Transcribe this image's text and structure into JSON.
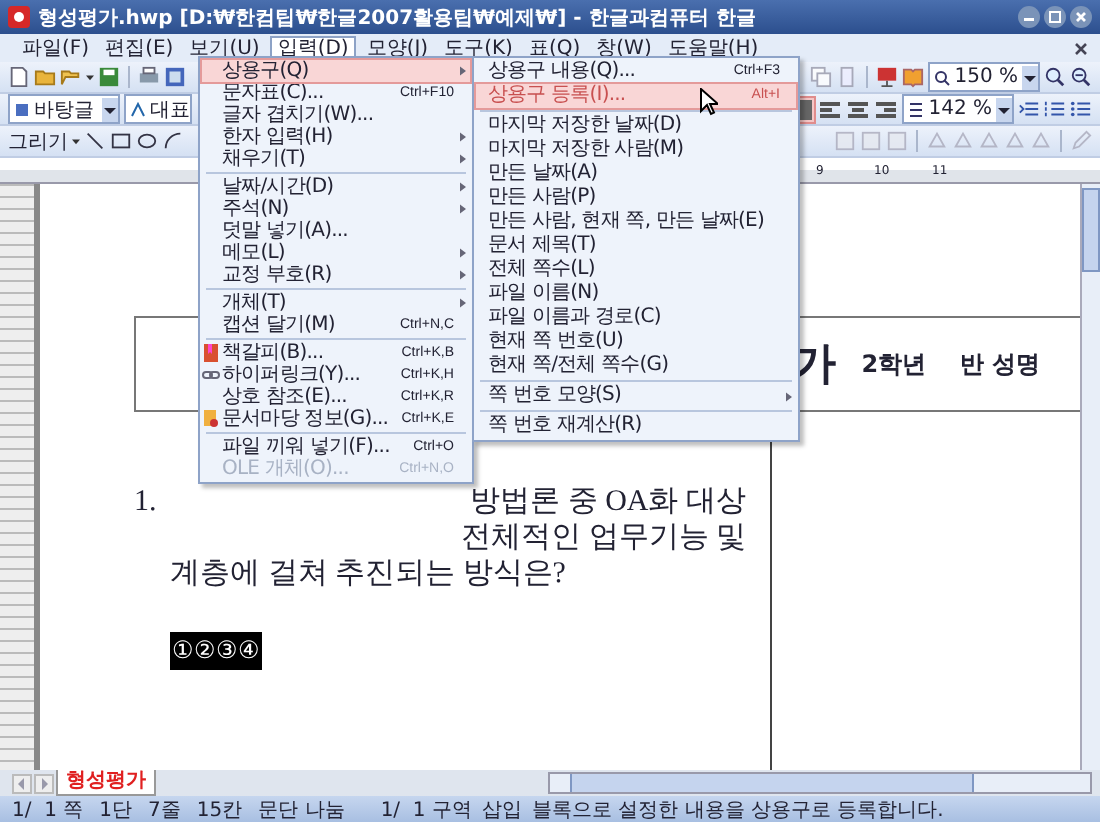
{
  "window": {
    "title": "형성평가.hwp [D:₩한컴팁₩한글2007활용팁₩예제₩] - 한글과컴퓨터 한글"
  },
  "menubar": [
    {
      "label": "파일(F)",
      "selected": false
    },
    {
      "label": "편집(E)",
      "selected": false
    },
    {
      "label": "보기(U)",
      "selected": false
    },
    {
      "label": "입력(D)",
      "selected": true
    },
    {
      "label": "모양(J)",
      "selected": false
    },
    {
      "label": "도구(K)",
      "selected": false
    },
    {
      "label": "표(Q)",
      "selected": false
    },
    {
      "label": "창(W)",
      "selected": false
    },
    {
      "label": "도움말(H)",
      "selected": false
    }
  ],
  "toolbar": {
    "style": "바탕글",
    "font": "대표",
    "zoom": "150 %",
    "paragraph_zoom": "142 %",
    "draw_label": "그리기",
    "alignment": [
      {
        "selected": true
      },
      {
        "selected": false
      },
      {
        "selected": false
      },
      {
        "selected": false
      }
    ]
  },
  "ruler": [
    "9",
    "10",
    "11"
  ],
  "insert_menu": [
    {
      "kind": "item",
      "label": "상용구(Q)",
      "submenu": true,
      "selected": true,
      "disabled": false
    },
    {
      "kind": "item",
      "label": "문자표(C)...",
      "shortcut": "Ctrl+F10",
      "submenu": false,
      "selected": false,
      "disabled": false
    },
    {
      "kind": "item",
      "label": "글자 겹치기(W)...",
      "submenu": false,
      "selected": false,
      "disabled": false
    },
    {
      "kind": "item",
      "label": "한자 입력(H)",
      "submenu": true,
      "selected": false,
      "disabled": false
    },
    {
      "kind": "item",
      "label": "채우기(T)",
      "submenu": true,
      "selected": false,
      "disabled": false
    },
    {
      "kind": "separator"
    },
    {
      "kind": "item",
      "label": "날짜/시간(D)",
      "submenu": true,
      "selected": false,
      "disabled": false
    },
    {
      "kind": "item",
      "label": "주석(N)",
      "submenu": true,
      "selected": false,
      "disabled": false
    },
    {
      "kind": "item",
      "label": "덧말 넣기(A)...",
      "submenu": false,
      "selected": false,
      "disabled": false
    },
    {
      "kind": "item",
      "label": "메모(L)",
      "submenu": true,
      "selected": false,
      "disabled": false
    },
    {
      "kind": "item",
      "label": "교정 부호(R)",
      "submenu": true,
      "selected": false,
      "disabled": false
    },
    {
      "kind": "separator"
    },
    {
      "kind": "item",
      "label": "개체(T)",
      "submenu": true,
      "selected": false,
      "disabled": false
    },
    {
      "kind": "item",
      "label": "캡션 달기(M)",
      "shortcut": "Ctrl+N,C",
      "submenu": false,
      "selected": false,
      "disabled": false
    },
    {
      "kind": "separator"
    },
    {
      "kind": "item",
      "label": "책갈피(B)...",
      "shortcut": "Ctrl+K,B",
      "icon": true,
      "submenu": false,
      "selected": false,
      "disabled": false
    },
    {
      "kind": "item",
      "label": "하이퍼링크(Y)...",
      "shortcut": "Ctrl+K,H",
      "icon": true,
      "submenu": false,
      "selected": false,
      "disabled": false
    },
    {
      "kind": "item",
      "label": "상호 참조(E)...",
      "shortcut": "Ctrl+K,R",
      "submenu": false,
      "selected": false,
      "disabled": false
    },
    {
      "kind": "item",
      "label": "문서마당 정보(G)...",
      "shortcut": "Ctrl+K,E",
      "icon": true,
      "submenu": false,
      "selected": false,
      "disabled": false
    },
    {
      "kind": "separator"
    },
    {
      "kind": "item",
      "label": "파일 끼워 넣기(F)...",
      "shortcut": "Ctrl+O",
      "submenu": false,
      "selected": false,
      "disabled": false
    },
    {
      "kind": "item",
      "label": "OLE 개체(O)...",
      "shortcut": "Ctrl+N,O",
      "submenu": false,
      "selected": false,
      "disabled": true
    }
  ],
  "autotext_submenu": [
    {
      "kind": "item",
      "label": "상용구 내용(Q)...",
      "shortcut": "Ctrl+F3",
      "submenu": false,
      "selected": false
    },
    {
      "kind": "item",
      "label": "상용구 등록(I)...",
      "shortcut": "Alt+I",
      "submenu": false,
      "selected": true
    },
    {
      "kind": "separator"
    },
    {
      "kind": "item",
      "label": "마지막 저장한 날짜(D)",
      "submenu": false,
      "selected": false
    },
    {
      "kind": "item",
      "label": "마지막 저장한 사람(M)",
      "submenu": false,
      "selected": false
    },
    {
      "kind": "item",
      "label": "만든 날짜(A)",
      "submenu": false,
      "selected": false
    },
    {
      "kind": "item",
      "label": "만든 사람(P)",
      "submenu": false,
      "selected": false
    },
    {
      "kind": "item",
      "label": "만든 사람, 현재 쪽, 만든 날짜(E)",
      "submenu": false,
      "selected": false
    },
    {
      "kind": "item",
      "label": "문서 제목(T)",
      "submenu": false,
      "selected": false
    },
    {
      "kind": "item",
      "label": "전체 쪽수(L)",
      "submenu": false,
      "selected": false
    },
    {
      "kind": "item",
      "label": "파일 이름(N)",
      "submenu": false,
      "selected": false
    },
    {
      "kind": "item",
      "label": "파일 이름과 경로(C)",
      "submenu": false,
      "selected": false
    },
    {
      "kind": "item",
      "label": "현재 쪽 번호(U)",
      "submenu": false,
      "selected": false
    },
    {
      "kind": "item",
      "label": "현재 쪽/전체 쪽수(G)",
      "submenu": false,
      "selected": false
    },
    {
      "kind": "separator"
    },
    {
      "kind": "item",
      "label": "쪽 번호 모양(S)",
      "submenu": true,
      "selected": false
    },
    {
      "kind": "separator"
    },
    {
      "kind": "item",
      "label": "쪽 번호 재계산(R)",
      "submenu": false,
      "selected": false
    }
  ],
  "document": {
    "title_fragment": "가",
    "class_info": "2학년    반 성명",
    "question_number": "1.",
    "lines": [
      "방법론 중 OA화 대상",
      "전체적인 업무기능 및",
      "계층에 걸쳐 추진되는 방식은?"
    ],
    "answers": "①②③④"
  },
  "sheet_tabs": [
    {
      "label": "형성평가",
      "selected": true
    }
  ],
  "status_bar": [
    "1/  1 쪽",
    "1단",
    "7줄",
    "15칸",
    "문단 나눔",
    "1/  1 구역",
    "삽입",
    "블록으로 설정한 내용을 상용구로 등록합니다."
  ]
}
